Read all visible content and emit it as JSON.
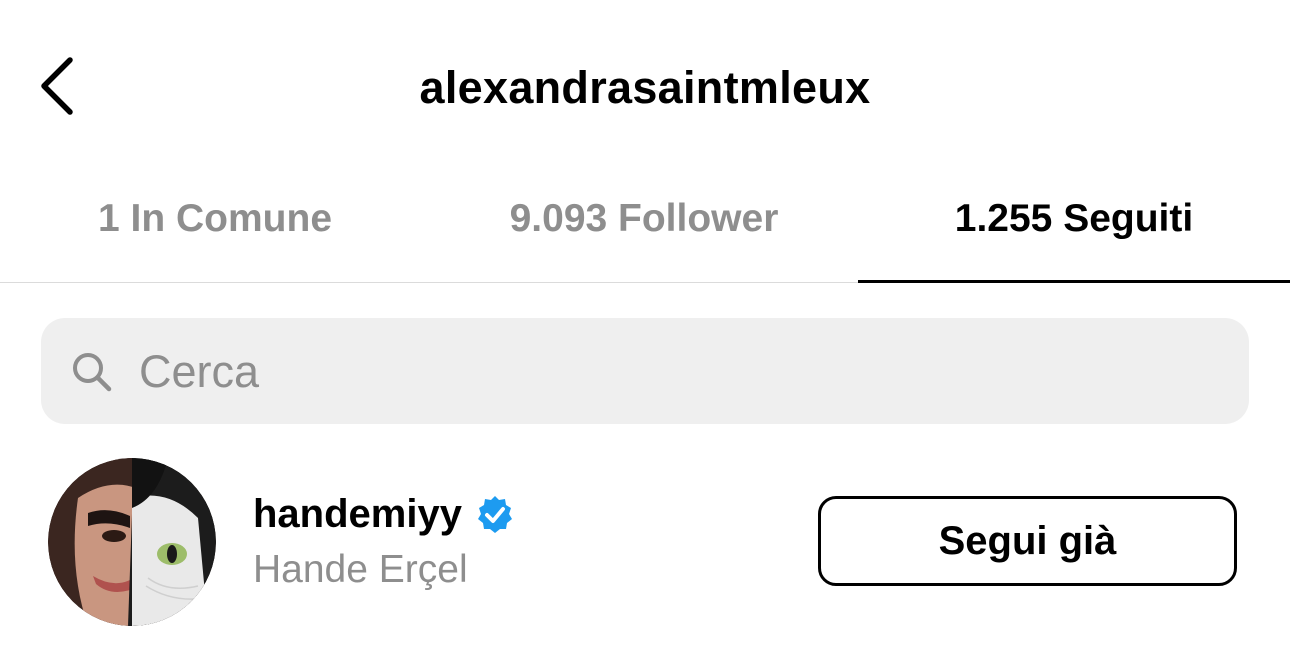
{
  "header": {
    "title": "alexandrasaintmleux",
    "back_icon": "chevron-left-icon"
  },
  "tabs": [
    {
      "label": "1 In Comune",
      "active": false
    },
    {
      "label": "9.093 Follower",
      "active": false
    },
    {
      "label": "1.255 Seguiti",
      "active": true
    }
  ],
  "search": {
    "placeholder": "Cerca",
    "icon": "search-icon"
  },
  "list": [
    {
      "username": "handemiyy",
      "verified": true,
      "full_name": "Hande Erçel",
      "button_label": "Segui già"
    }
  ],
  "colors": {
    "text_primary": "#000000",
    "text_secondary": "#8e8e8e",
    "search_bg": "#efefef",
    "divider": "#dbdbdb",
    "verified_badge": "#1d9bf0"
  }
}
